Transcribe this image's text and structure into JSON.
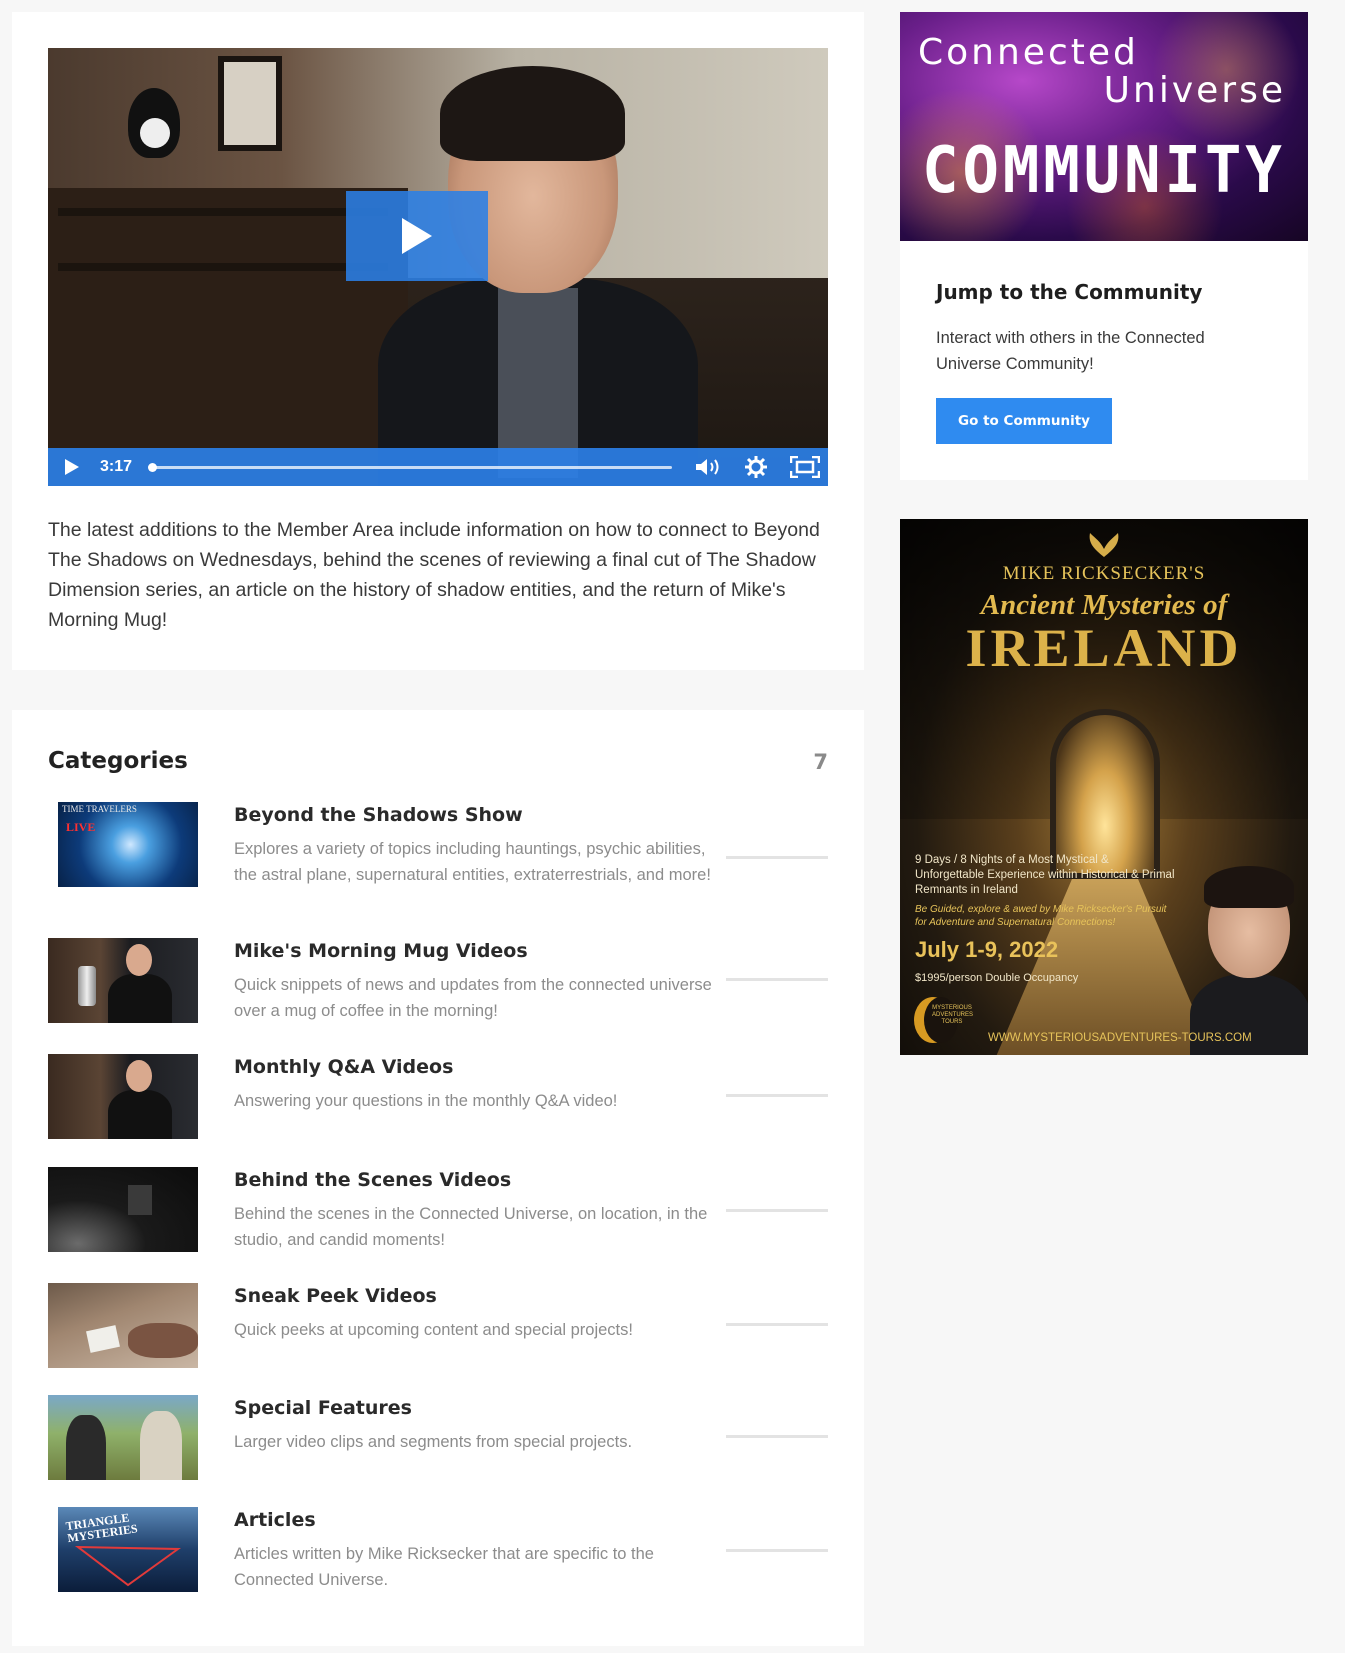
{
  "video": {
    "time": "3:17",
    "progress": 0.0,
    "description": "The latest additions to the Member Area include information on how to connect to Beyond The Shadows on Wednesdays, behind the scenes of reviewing a final cut of The Shadow Dimension series, an article on the history of shadow entities, and the return of Mike's Morning Mug!",
    "accent_color": "#2b7fe6"
  },
  "categories": {
    "title": "Categories",
    "count": "7",
    "items": [
      {
        "title": "Beyond the Shadows Show",
        "description": "Explores a variety of topics including hauntings, psychic abilities, the astral plane, supernatural entities, extraterrestrials, and more!",
        "thumb_text_1": "TIME TRAVELERS",
        "thumb_text_2": "LIVE"
      },
      {
        "title": "Mike's Morning Mug Videos",
        "description": "Quick snippets of news and updates from the connected universe over a mug of coffee in the morning!"
      },
      {
        "title": "Monthly Q&A Videos",
        "description": "Answering your questions in the monthly Q&A video!"
      },
      {
        "title": "Behind the Scenes Videos",
        "description": "Behind the scenes in the Connected Universe, on location, in the studio, and candid moments!"
      },
      {
        "title": "Sneak Peek Videos",
        "description": "Quick peeks at upcoming content and special projects!"
      },
      {
        "title": "Special Features",
        "description": "Larger video clips and segments from special projects."
      },
      {
        "title": "Articles",
        "description": "Articles written by Mike Ricksecker that are specific to the Connected Universe.",
        "thumb_text_1": "TRIANGLE MYSTERIES"
      }
    ]
  },
  "community": {
    "banner_line1": "Connected",
    "banner_line2": "Universe",
    "banner_line3": "COMMUNITY",
    "title": "Jump to the Community",
    "description": "Interact with others in the Connected Universe Community!",
    "button_label": "Go to Community",
    "button_color": "#2f8bf0"
  },
  "tour": {
    "brand": "MIKE RICKSECKER'S",
    "title_line1": "Ancient Mysteries of",
    "title_line2": "IRELAND",
    "days": "9 Days / 8 Nights of a Most Mystical & Unforgettable Experience within Historical & Primal Remnants in Ireland",
    "guided": "Be Guided, explore & awed by Mike Ricksecker's Pursuit for Adventure and Supernatural Connections!",
    "dates": "July 1-9, 2022",
    "price": "$1995/person Double Occupancy",
    "logo_text": "MYSTERIOUS ADVENTURES TOURS",
    "website": "WWW.MYSTERIOUSADVENTURES-TOURS.COM"
  }
}
